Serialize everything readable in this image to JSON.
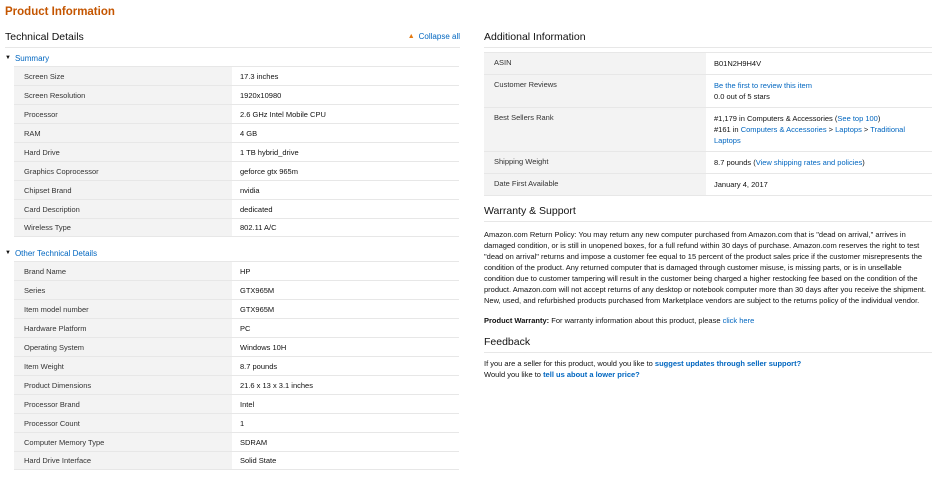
{
  "page_title": "Product Information",
  "technical": {
    "heading": "Technical Details",
    "collapse_label": "Collapse all",
    "summary_label": "Summary",
    "summary_rows": [
      {
        "k": "Screen Size",
        "v": "17.3 inches"
      },
      {
        "k": "Screen Resolution",
        "v": "1920x10980"
      },
      {
        "k": "Processor",
        "v": "2.6 GHz Intel Mobile CPU"
      },
      {
        "k": "RAM",
        "v": "4 GB"
      },
      {
        "k": "Hard Drive",
        "v": "1 TB hybrid_drive"
      },
      {
        "k": "Graphics Coprocessor",
        "v": "geforce gtx 965m"
      },
      {
        "k": "Chipset Brand",
        "v": "nvidia"
      },
      {
        "k": "Card Description",
        "v": "dedicated"
      },
      {
        "k": "Wireless Type",
        "v": "802.11 A/C"
      }
    ],
    "other_label": "Other Technical Details",
    "other_rows": [
      {
        "k": "Brand Name",
        "v": "HP"
      },
      {
        "k": "Series",
        "v": "GTX965M"
      },
      {
        "k": "Item model number",
        "v": "GTX965M"
      },
      {
        "k": "Hardware Platform",
        "v": "PC"
      },
      {
        "k": "Operating System",
        "v": "Windows 10H"
      },
      {
        "k": "Item Weight",
        "v": "8.7 pounds"
      },
      {
        "k": "Product Dimensions",
        "v": "21.6 x 13 x 3.1 inches"
      },
      {
        "k": "Processor Brand",
        "v": "Intel"
      },
      {
        "k": "Processor Count",
        "v": "1"
      },
      {
        "k": "Computer Memory Type",
        "v": "SDRAM"
      },
      {
        "k": "Hard Drive Interface",
        "v": "Solid State"
      }
    ]
  },
  "additional": {
    "heading": "Additional Information",
    "asin_label": "ASIN",
    "asin_value": "B01N2H9H4V",
    "reviews_label": "Customer Reviews",
    "reviews_link": "Be the first to review this item",
    "reviews_stars": "0.0 out of 5 stars",
    "rank_label": "Best Sellers Rank",
    "rank1_prefix": "#1,179 in Computers & Accessories (",
    "rank1_link": "See top 100",
    "rank1_suffix": ")",
    "rank2_prefix": "#161 in ",
    "rank2_link1": "Computers & Accessories",
    "rank2_sep1": " > ",
    "rank2_link2": "Laptops",
    "rank2_sep2": " > ",
    "rank2_link3": "Traditional Laptops",
    "shipping_label": "Shipping Weight",
    "shipping_prefix": "8.7 pounds (",
    "shipping_link": "View shipping rates and policies",
    "shipping_suffix": ")",
    "date_label": "Date First Available",
    "date_value": "January 4, 2017"
  },
  "warranty": {
    "heading": "Warranty & Support",
    "text": "Amazon.com Return Policy: You may return any new computer purchased from Amazon.com that is \"dead on arrival,\" arrives in damaged condition, or is still in unopened boxes, for a full refund within 30 days of purchase. Amazon.com reserves the right to test \"dead on arrival\" returns and impose a customer fee equal to 15 percent of the product sales price if the customer misrepresents the condition of the product. Any returned computer that is damaged through customer misuse, is missing parts, or is in unsellable condition due to customer tampering will result in the customer being charged a higher restocking fee based on the condition of the product. Amazon.com will not accept returns of any desktop or notebook computer more than 30 days after you receive the shipment. New, used, and refurbished products purchased from Marketplace vendors are subject to the returns policy of the individual vendor.",
    "pw_label": "Product Warranty:",
    "pw_text": " For warranty information about this product, please ",
    "pw_link": "click here"
  },
  "feedback": {
    "heading": "Feedback",
    "line1_text": "If you are a seller for this product, would you like to ",
    "line1_link": "suggest updates through seller support?",
    "line2_text": "Would you like to ",
    "line2_link": "tell us about a lower price?"
  }
}
